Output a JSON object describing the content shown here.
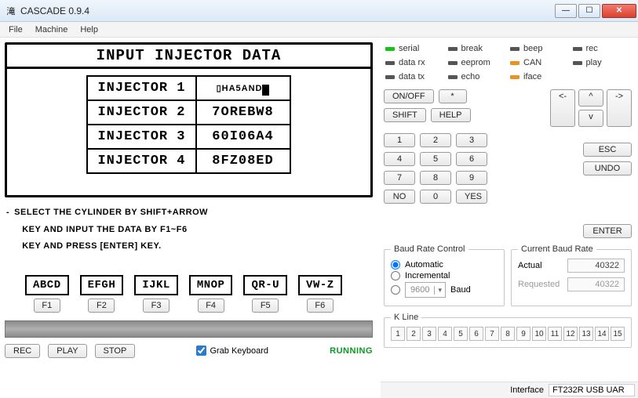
{
  "window": {
    "title": "CASCADE 0.9.4",
    "icon_glyph": "滝"
  },
  "menu": {
    "file": "File",
    "machine": "Machine",
    "help": "Help"
  },
  "lcd": {
    "title": "INPUT INJECTOR DATA",
    "rows": [
      {
        "label": "INJECTOR 1",
        "value": "HA5AND",
        "cursor": true
      },
      {
        "label": "INJECTOR 2",
        "value": "7OREBW8",
        "cursor": false
      },
      {
        "label": "INJECTOR 3",
        "value": "60I06A4",
        "cursor": false
      },
      {
        "label": "INJECTOR 4",
        "value": "8FZ08ED",
        "cursor": false
      }
    ],
    "instruction_l1": "SELECT THE CYLINDER BY SHIFT+ARROW",
    "instruction_l2": "KEY AND INPUT THE DATA BY F1~F6",
    "instruction_l3": "KEY AND PRESS [ENTER] KEY."
  },
  "fkeys": [
    {
      "box": "ABCD",
      "key": "F1"
    },
    {
      "box": "EFGH",
      "key": "F2"
    },
    {
      "box": "IJKL",
      "key": "F3"
    },
    {
      "box": "MNOP",
      "key": "F4"
    },
    {
      "box": "QR-U",
      "key": "F5"
    },
    {
      "box": "VW-Z",
      "key": "F6"
    }
  ],
  "bottom": {
    "rec": "REC",
    "play": "PLAY",
    "stop": "STOP",
    "grab": "Grab Keyboard",
    "grab_checked": true,
    "status": "RUNNING"
  },
  "leds": [
    {
      "name": "serial",
      "color": "green"
    },
    {
      "name": "break",
      "color": "dark"
    },
    {
      "name": "beep",
      "color": "dark"
    },
    {
      "name": "rec",
      "color": "dark"
    },
    {
      "name": "data rx",
      "color": "dark"
    },
    {
      "name": "eeprom",
      "color": "dark"
    },
    {
      "name": "CAN",
      "color": "orange"
    },
    {
      "name": "play",
      "color": "dark"
    },
    {
      "name": "data tx",
      "color": "dark"
    },
    {
      "name": "echo",
      "color": "dark"
    },
    {
      "name": "iface",
      "color": "orange"
    },
    {
      "name": "",
      "color": "none"
    }
  ],
  "ctrl": {
    "onoff": "ON/OFF",
    "star": "*",
    "shift": "SHIFT",
    "help": "HELP",
    "left": "<-",
    "up": "^",
    "down": "v",
    "right": "->",
    "esc": "ESC",
    "undo": "UNDO",
    "enter": "ENTER",
    "no": "NO",
    "yes": "YES",
    "n1": "1",
    "n2": "2",
    "n3": "3",
    "n4": "4",
    "n5": "5",
    "n6": "6",
    "n7": "7",
    "n8": "8",
    "n9": "9",
    "n0": "0"
  },
  "baud_ctrl": {
    "legend": "Baud Rate Control",
    "auto": "Automatic",
    "inc": "Incremental",
    "combo_value": "9600",
    "baud_label": "Baud",
    "selected": "auto"
  },
  "baud_rate": {
    "legend": "Current Baud Rate",
    "actual_label": "Actual",
    "actual": "40322",
    "req_label": "Requested",
    "req": "40322"
  },
  "kline": {
    "legend": "K Line",
    "cells": [
      "1",
      "2",
      "3",
      "4",
      "5",
      "6",
      "7",
      "8",
      "9",
      "10",
      "11",
      "12",
      "13",
      "14",
      "15"
    ]
  },
  "status": {
    "iface_label": "Interface",
    "iface": "FT232R USB UAR"
  }
}
